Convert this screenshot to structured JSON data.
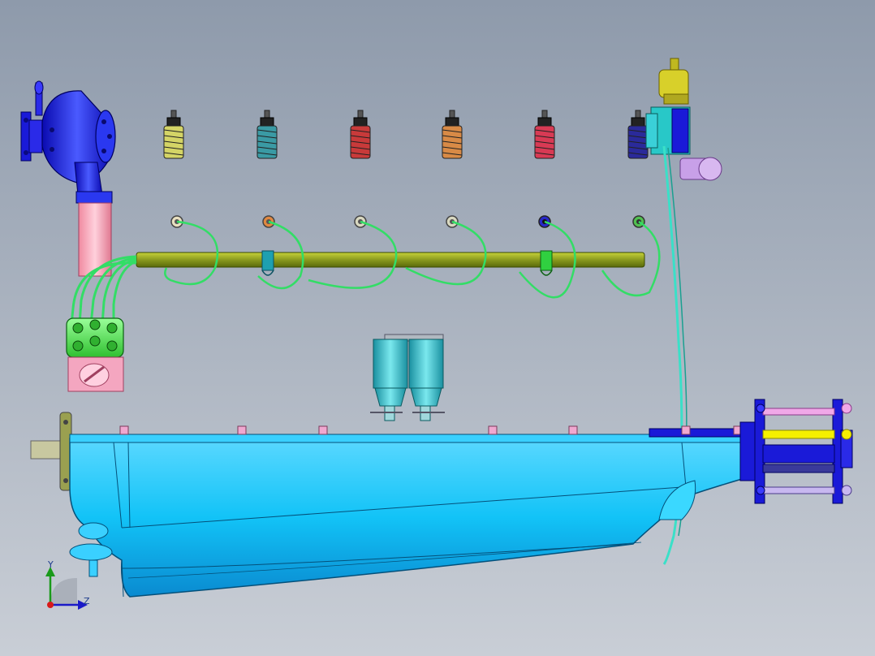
{
  "view": {
    "background_top": "#8e9aab",
    "background_bottom": "#c9ced6"
  },
  "triad": {
    "y_label": "Y",
    "z_label": "Z"
  },
  "colors": {
    "pan_body": "#12c3f7",
    "pan_dark": "#0a8ad0",
    "rail": "#8a9a1e",
    "wire": "#33dd66",
    "flange": "#1a1ad8",
    "pipe": "#ffb6c8",
    "filter": "#28c8d2",
    "yellow_rod": "#f5f000",
    "violet_rod": "#e48af0"
  },
  "spark_plugs": [
    {
      "name": "plug-1",
      "color": "#d4d466"
    },
    {
      "name": "plug-2",
      "color": "#3a9aa4"
    },
    {
      "name": "plug-3",
      "color": "#c83a3a"
    },
    {
      "name": "plug-4",
      "color": "#d88a46"
    },
    {
      "name": "plug-5",
      "color": "#d83a54"
    },
    {
      "name": "plug-6",
      "color": "#2a2a9a"
    }
  ]
}
